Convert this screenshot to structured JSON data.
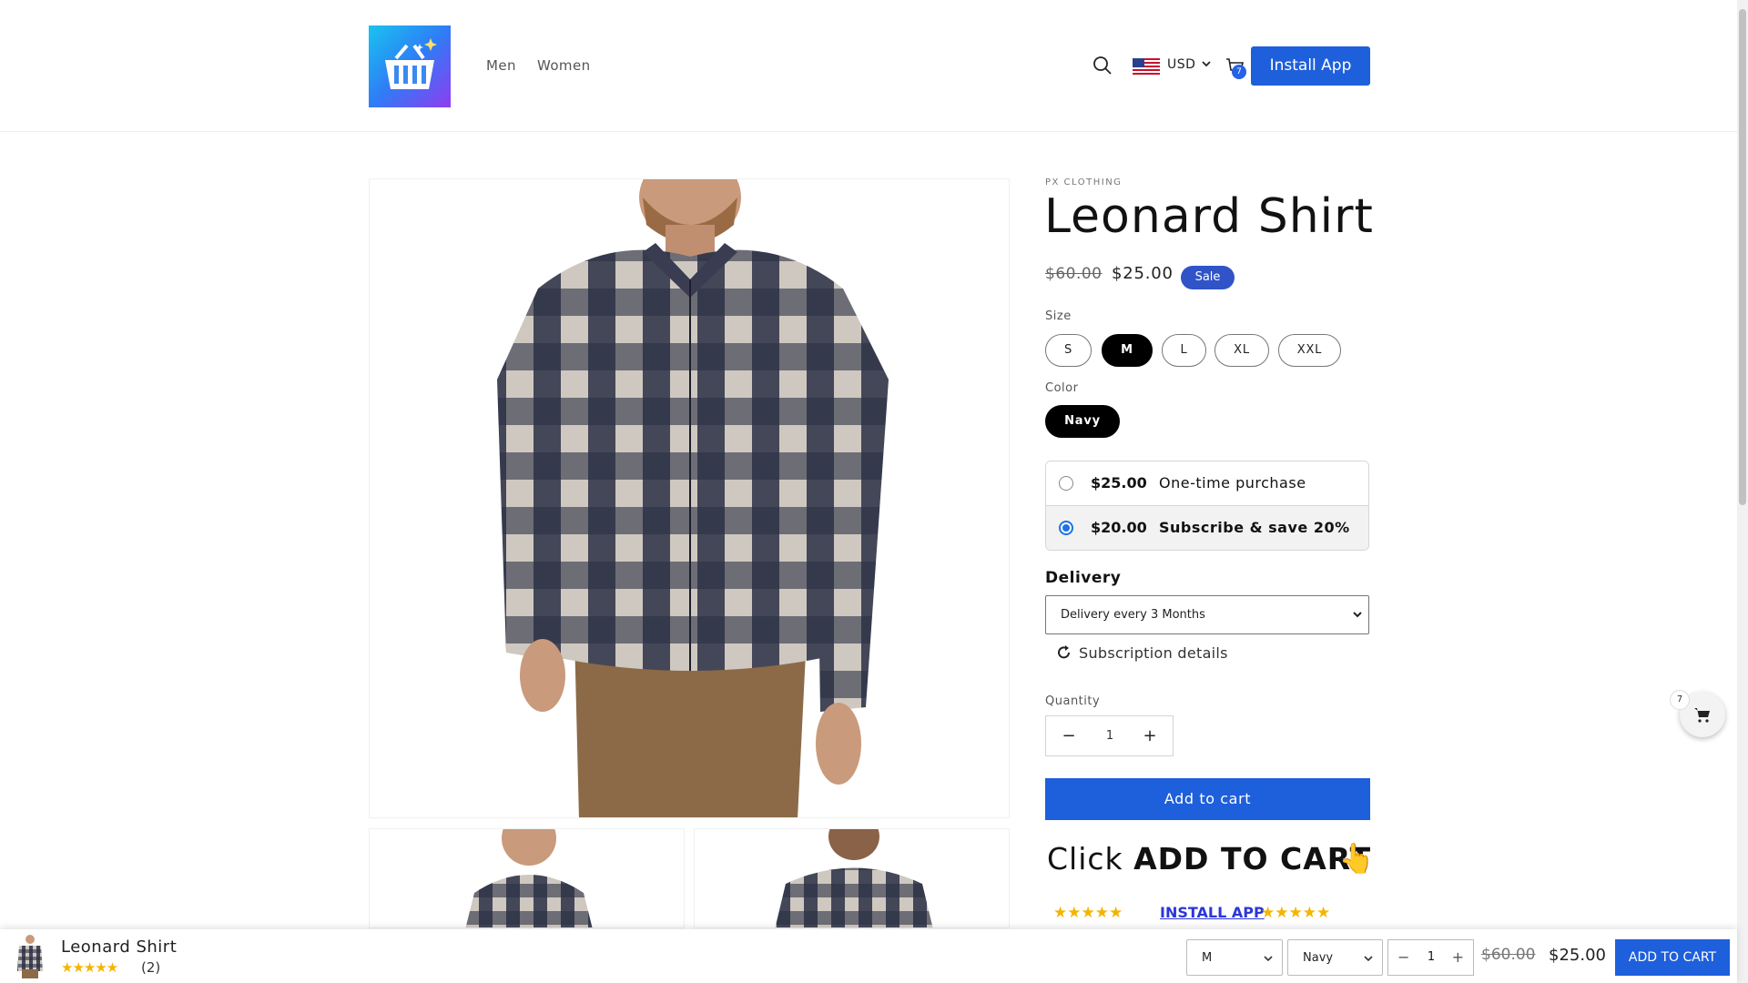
{
  "header": {
    "nav": [
      "Men",
      "Women"
    ],
    "currency": "USD",
    "cart_count": "7",
    "install_label": "Install App",
    "accent": "#1e5fdc"
  },
  "product": {
    "vendor": "PX CLOTHING",
    "title": "Leonard Shirt",
    "compare_price": "$60.00",
    "price": "$25.00",
    "badge": "Sale",
    "size_label": "Size",
    "sizes": [
      "S",
      "M",
      "L",
      "XL",
      "XXL"
    ],
    "selected_size": "M",
    "color_label": "Color",
    "colors": [
      "Navy"
    ],
    "selected_color": "Navy"
  },
  "subscription": {
    "options": [
      {
        "price": "$25.00",
        "label": "One-time purchase",
        "selected": false
      },
      {
        "price": "$20.00",
        "label": "Subscribe & save 20%",
        "selected": true
      }
    ],
    "delivery_label": "Delivery",
    "delivery_value": "Delivery every 3 Months",
    "details_label": "Subscription details"
  },
  "quantity": {
    "label": "Quantity",
    "value": "1"
  },
  "cta": {
    "add_to_cart": "Add to cart",
    "click_prefix": "Click ",
    "click_bold": "ADD TO CART",
    "stars": "★★★★★",
    "install_link": "INSTALL APP"
  },
  "floating_cart": {
    "count": "7"
  },
  "sticky_bar": {
    "title": "Leonard Shirt",
    "stars": "★★★★★",
    "review_count": "(2)",
    "size": "M",
    "color": "Navy",
    "qty": "1",
    "compare_price": "$60.00",
    "price": "$25.00",
    "add_label": "ADD TO CART"
  }
}
